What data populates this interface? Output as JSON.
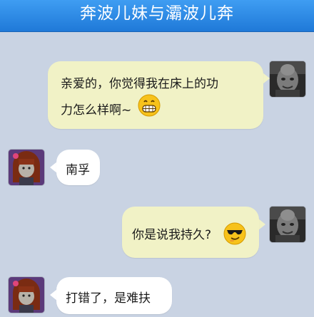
{
  "header": {
    "title": "奔波儿妹与灞波儿奔"
  },
  "messages": [
    {
      "side": "right",
      "line1": "亲爱的，你觉得我在床上的功",
      "line2": "力怎么样啊~",
      "emoji": "grinning-face-icon"
    },
    {
      "side": "left",
      "text": "南孚"
    },
    {
      "side": "right",
      "text": "你是说我持久?",
      "emoji": "sunglasses-face-icon"
    },
    {
      "side": "left",
      "text": "打错了，是难扶"
    }
  ],
  "colors": {
    "title_bar": "#2b8ae6",
    "background": "#c9d3e3",
    "outgoing_bubble": "#f1f2c6",
    "incoming_bubble": "#ffffff",
    "emoji_yellow": "#f7c21b"
  }
}
